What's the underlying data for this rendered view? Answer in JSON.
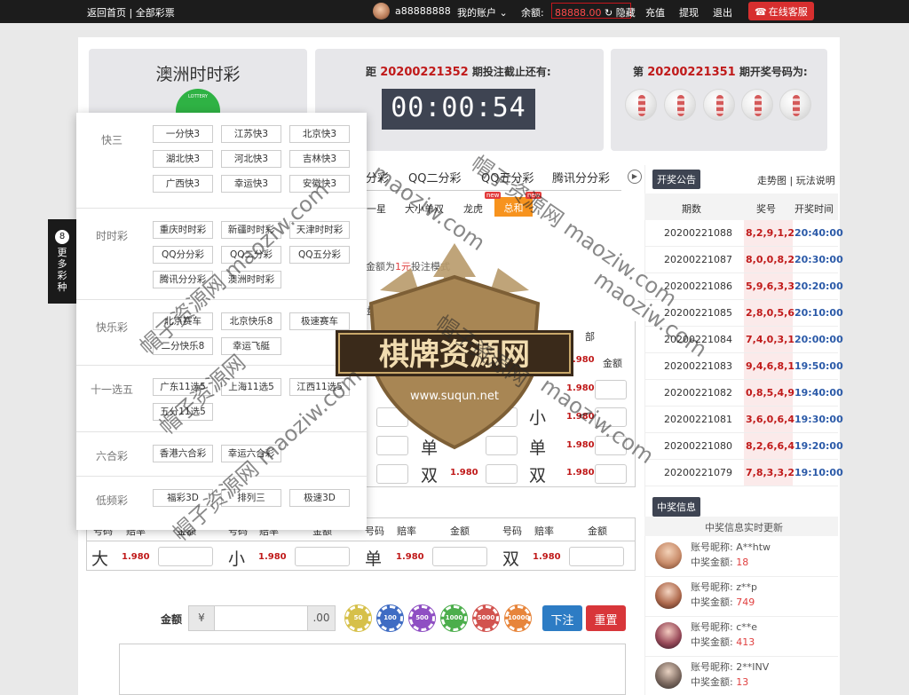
{
  "topbar": {
    "home": "返回首页 | 全部彩票",
    "username": "a88888888",
    "account": "我的账户",
    "balance_label": "余额:",
    "balance_value": "88888.00",
    "hide": "隐藏",
    "recharge": "充值",
    "withdraw": "提现",
    "logout": "退出",
    "service": "在线客服"
  },
  "lottery": {
    "name": "澳洲时时彩",
    "logo_text": "LOTTERY",
    "cur_prefix": "距",
    "cur_period": "20200221352",
    "cur_suffix": "期投注截止还有:",
    "countdown": "00:00:54",
    "prev_prefix": "第",
    "prev_period": "20200221351",
    "prev_suffix": "期开奖号码为:"
  },
  "game_tabs": [
    "分彩",
    "QQ二分彩",
    "QQ五分彩",
    "腾讯分分彩"
  ],
  "sub_tabs": [
    "一星",
    "大小单双",
    "龙虎",
    "总和"
  ],
  "new_badge": "new",
  "hint": {
    "prefix": "金额为",
    "value": "1元",
    "suffix": "投注模式"
  },
  "bet_board": {
    "label_pan": "盘",
    "label_bu": "部",
    "header": {
      "code": "号码",
      "odds": "赔率",
      "amount": "金额"
    },
    "odds": "1.980",
    "partial_big": [
      "小",
      "单",
      "双"
    ],
    "bottom_row": [
      "大",
      "小",
      "单",
      "双"
    ]
  },
  "bet_controls": {
    "amount_label": "金额",
    "currency": "¥",
    "decimals": ".00",
    "chips": [
      {
        "label": "50",
        "color": "#d6c04a"
      },
      {
        "label": "100",
        "color": "#3f6cc3"
      },
      {
        "label": "500",
        "color": "#8f4fc3"
      },
      {
        "label": "1000",
        "color": "#4cae4c"
      },
      {
        "label": "5000",
        "color": "#d2534f"
      },
      {
        "label": "10000",
        "color": "#e7853b"
      }
    ],
    "bet": "下注",
    "reset": "重置"
  },
  "results": {
    "notice": "开奖公告",
    "links": "走势图 | 玩法说明",
    "headers": [
      "期数",
      "奖号",
      "开奖时间"
    ],
    "rows": [
      {
        "period": "20200221088",
        "nums": "8,2,9,1,2",
        "time": "20:40:00"
      },
      {
        "period": "20200221087",
        "nums": "8,0,0,8,2",
        "time": "20:30:00"
      },
      {
        "period": "20200221086",
        "nums": "5,9,6,3,3",
        "time": "20:20:00"
      },
      {
        "period": "20200221085",
        "nums": "2,8,0,5,6",
        "time": "20:10:00"
      },
      {
        "period": "20200221084",
        "nums": "7,4,0,3,1",
        "time": "20:00:00"
      },
      {
        "period": "20200221083",
        "nums": "9,4,6,8,1",
        "time": "19:50:00"
      },
      {
        "period": "20200221082",
        "nums": "0,8,5,4,9",
        "time": "19:40:00"
      },
      {
        "period": "20200221081",
        "nums": "3,6,0,6,4",
        "time": "19:30:00"
      },
      {
        "period": "20200221080",
        "nums": "8,2,6,6,4",
        "time": "19:20:00"
      },
      {
        "period": "20200221079",
        "nums": "7,8,3,3,2",
        "time": "19:10:00"
      }
    ]
  },
  "winners": {
    "title": "中奖信息",
    "subtitle": "中奖信息实时更新",
    "name_label": "账号昵称:",
    "amount_label": "中奖金额:",
    "rows": [
      {
        "name": "A**htw",
        "amount": "18"
      },
      {
        "name": "z**p",
        "amount": "749"
      },
      {
        "name": "c**e",
        "amount": "413"
      },
      {
        "name": "2**INV",
        "amount": "13"
      }
    ]
  },
  "menu": {
    "groups": [
      {
        "name": "快三",
        "items": [
          "一分快3",
          "江苏快3",
          "北京快3",
          "湖北快3",
          "河北快3",
          "吉林快3",
          "广西快3",
          "幸运快3",
          "安徽快3"
        ]
      },
      {
        "name": "时时彩",
        "items": [
          "重庆时时彩",
          "新疆时时彩",
          "天津时时彩",
          "QQ分分彩",
          "QQ二分彩",
          "QQ五分彩",
          "腾讯分分彩",
          "澳洲时时彩"
        ]
      },
      {
        "name": "快乐彩",
        "items": [
          "北京赛车",
          "北京快乐8",
          "极速赛车",
          "二分快乐8",
          "幸运飞艇"
        ]
      },
      {
        "name": "十一选五",
        "items": [
          "广东11选5",
          "上海11选5",
          "江西11选5",
          "五分11选5"
        ]
      },
      {
        "name": "六合彩",
        "items": [
          "香港六合彩",
          "幸运六合彩"
        ]
      },
      {
        "name": "低频彩",
        "items": [
          "福彩3D",
          "排列三",
          "极速3D"
        ]
      }
    ],
    "more_num": "8",
    "more_label": "更多彩种"
  },
  "overlay": {
    "brand": "棋牌资源网",
    "url": "www.suqun.net",
    "wm1": "帽子资源网 maoziw.com",
    "wm2": "maoziw.com",
    "wm3": "帽子资源网"
  }
}
